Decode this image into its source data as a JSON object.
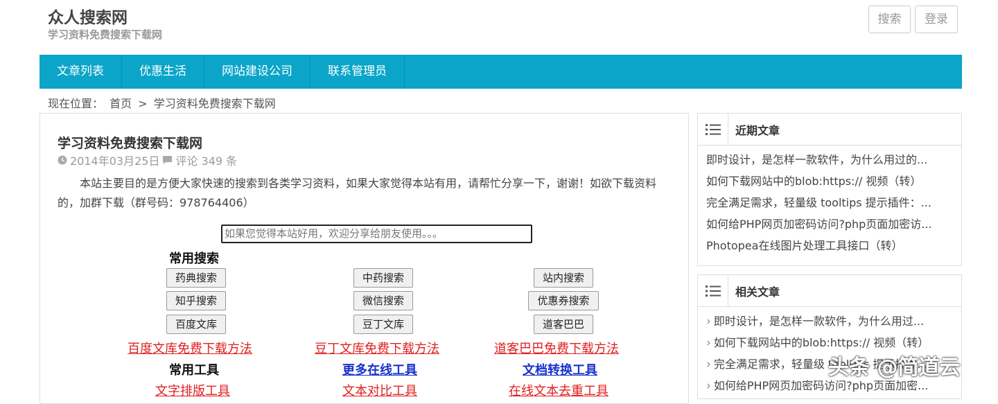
{
  "header": {
    "site_title": "众人搜索网",
    "site_subtitle": "学习资料免费搜索下载网",
    "search_button": "搜索",
    "login_button": "登录"
  },
  "nav": {
    "items": [
      "文章列表",
      "优惠生活",
      "网站建设公司",
      "联系管理员"
    ]
  },
  "breadcrumb": {
    "label": "现在位置：",
    "home": "首页",
    "sep": ">",
    "current": "学习资料免费搜索下载网"
  },
  "post": {
    "title": "学习资料免费搜索下载网",
    "date": "2014年03月25日",
    "comments": "评论 349 条",
    "body": "本站主要目的是方便大家快速的搜索到各类学习资料，如果大家觉得本站有用，请帮忙分享一下，谢谢！如欲下载资料的，加群下载（群号码：978764406）",
    "share_text": "如果您觉得本站好用，欢迎分享给朋友使用。。。"
  },
  "tools": {
    "common_search_heading": "常用搜索",
    "buttons": [
      "药典搜索",
      "中药搜索",
      "站内搜索",
      "知乎搜索",
      "微信搜索",
      "优惠券搜索",
      "百度文库",
      "豆丁文库",
      "道客巴巴"
    ],
    "download_links": [
      "百度文库免费下载方法",
      "豆丁文库免费下载方法",
      "道客巴巴免费下载方法"
    ],
    "common_tools_heading": "常用工具",
    "more_tools": "更多在线工具",
    "doc_convert": "文档转换工具",
    "bottom_links": [
      "文字排版工具",
      "文本对比工具",
      "在线文本去重工具"
    ]
  },
  "sidebar": {
    "recent_title": "近期文章",
    "recent_items": [
      "即时设计，是怎样一款软件，为什么用过的...",
      "如何下载网站中的blob:https:// 视频（转）",
      "完全满足需求，轻量级 tooltips 提示插件：...",
      "如何给PHP网页加密码访问?php页面加密访...",
      "Photopea在线图片处理工具接口（转）"
    ],
    "related_title": "相关文章",
    "related_items": [
      "即时设计，是怎样一款软件，为什么用过...",
      "如何下载网站中的blob:https:// 视频（转）",
      "完全满足需求，轻量级 tooltips 提示插件...",
      "如何给PHP网页加密码访问?php页面加密..."
    ]
  },
  "watermark": "头条 @简道云",
  "colors": {
    "nav_bg": "#0aa5c8",
    "link_red": "#e02020",
    "link_blue": "#1a33cc"
  }
}
